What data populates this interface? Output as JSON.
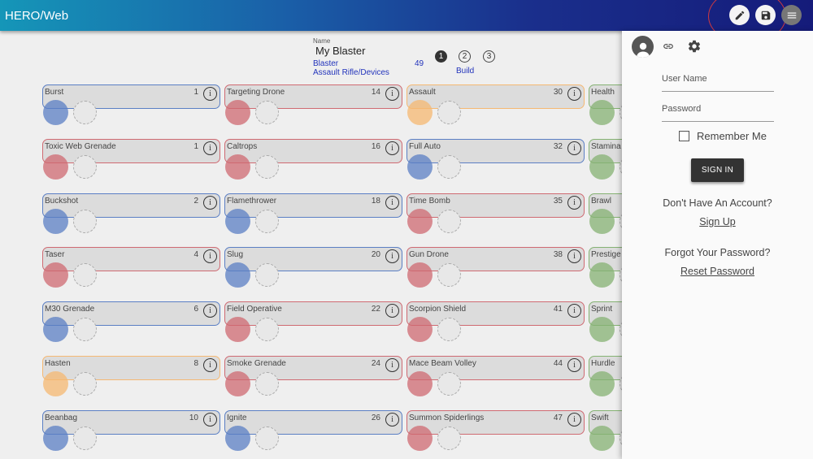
{
  "app": {
    "title": "HERO/Web"
  },
  "build": {
    "name_label": "Name",
    "name": "My Blaster",
    "archetype": "Blaster",
    "powersets": "Assault Rifle/Devices",
    "level": "49",
    "build_tab": "Build",
    "steps": [
      "1",
      "2",
      "3"
    ]
  },
  "colors": {
    "blue": "#5b7fc4",
    "red": "#cf6a72",
    "orange": "#f5b872",
    "green": "#85b273"
  },
  "columns": [
    {
      "powers": [
        {
          "name": "Burst",
          "level": "1",
          "color": "blue"
        },
        {
          "name": "Toxic Web Grenade",
          "level": "1",
          "color": "red"
        },
        {
          "name": "Buckshot",
          "level": "2",
          "color": "blue"
        },
        {
          "name": "Taser",
          "level": "4",
          "color": "red"
        },
        {
          "name": "M30 Grenade",
          "level": "6",
          "color": "blue"
        },
        {
          "name": "Hasten",
          "level": "8",
          "color": "orange"
        },
        {
          "name": "Beanbag",
          "level": "10",
          "color": "blue"
        }
      ]
    },
    {
      "powers": [
        {
          "name": "Targeting Drone",
          "level": "14",
          "color": "red"
        },
        {
          "name": "Caltrops",
          "level": "16",
          "color": "red"
        },
        {
          "name": "Flamethrower",
          "level": "18",
          "color": "blue"
        },
        {
          "name": "Slug",
          "level": "20",
          "color": "blue"
        },
        {
          "name": "Field Operative",
          "level": "22",
          "color": "red"
        },
        {
          "name": "Smoke Grenade",
          "level": "24",
          "color": "red"
        },
        {
          "name": "Ignite",
          "level": "26",
          "color": "blue"
        }
      ]
    },
    {
      "powers": [
        {
          "name": "Assault",
          "level": "30",
          "color": "orange"
        },
        {
          "name": "Full Auto",
          "level": "32",
          "color": "blue"
        },
        {
          "name": "Time Bomb",
          "level": "35",
          "color": "red"
        },
        {
          "name": "Gun Drone",
          "level": "38",
          "color": "red"
        },
        {
          "name": "Scorpion Shield",
          "level": "41",
          "color": "red"
        },
        {
          "name": "Mace Beam Volley",
          "level": "44",
          "color": "red"
        },
        {
          "name": "Summon Spiderlings",
          "level": "47",
          "color": "red"
        }
      ]
    },
    {
      "powers": [
        {
          "name": "Health",
          "level": "",
          "color": "green"
        },
        {
          "name": "Stamina",
          "level": "",
          "color": "green"
        },
        {
          "name": "Brawl",
          "level": "",
          "color": "green"
        },
        {
          "name": "Prestige",
          "level": "",
          "color": "green"
        },
        {
          "name": "Sprint",
          "level": "",
          "color": "green"
        },
        {
          "name": "Hurdle",
          "level": "",
          "color": "green"
        },
        {
          "name": "Swift",
          "level": "",
          "color": "green"
        }
      ]
    }
  ],
  "info_glyph": "i",
  "login": {
    "username_label": "User Name",
    "password_label": "Password",
    "remember_label": "Remember Me",
    "signin_label": "SIGN IN",
    "no_account_text": "Don't Have An Account?",
    "signup_label": "Sign Up",
    "forgot_text": "Forgot Your Password?",
    "reset_label": "Reset Password"
  }
}
